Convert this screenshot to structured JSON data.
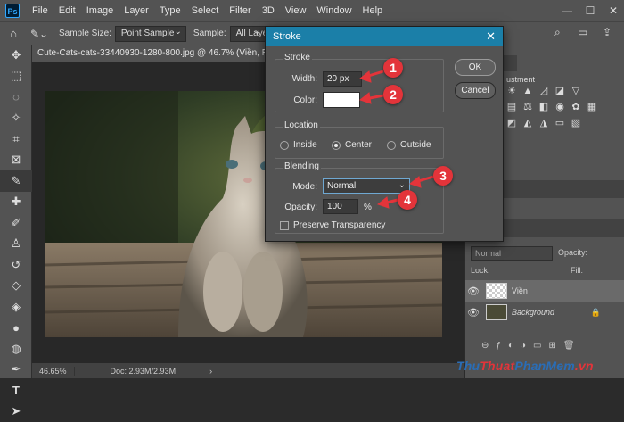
{
  "menubar": {
    "logo": "Ps",
    "items": [
      "File",
      "Edit",
      "Image",
      "Layer",
      "Type",
      "Select",
      "Filter",
      "3D",
      "View",
      "Window",
      "Help"
    ],
    "controls": [
      "—",
      "☐",
      "✕"
    ]
  },
  "options_bar": {
    "sample_size_label": "Sample Size:",
    "sample_size_value": "Point Sample",
    "sample_label": "Sample:",
    "sample_value": "All Layers"
  },
  "document": {
    "tab_title": "Cute-Cats-cats-33440930-1280-800.jpg @ 46.7% (Viền, RGB/8#) *",
    "zoom": "46.65%",
    "doc_size": "Doc: 2.93M/2.93M"
  },
  "stroke_dialog": {
    "title": "Stroke",
    "stroke_group": "Stroke",
    "width_label": "Width:",
    "width_value": "20 px",
    "color_label": "Color:",
    "color_value": "#ffffff",
    "location_group": "Location",
    "location_options": [
      "Inside",
      "Center",
      "Outside"
    ],
    "location_selected": "Center",
    "blending_group": "Blending",
    "mode_label": "Mode:",
    "mode_value": "Normal",
    "opacity_label": "Opacity:",
    "opacity_value": "100",
    "opacity_unit": "%",
    "preserve_label": "Preserve Transparency",
    "ok_label": "OK",
    "cancel_label": "Cancel"
  },
  "callouts": [
    "1",
    "2",
    "3",
    "4"
  ],
  "right_panel": {
    "adjustments_title": "ustment",
    "tab_fragment": "ts",
    "blend_mode": "Normal",
    "opacity_label": "Opacity:",
    "lock_label": "Lock:",
    "fill_label": "Fill:",
    "layers": [
      {
        "name": "Viền",
        "selected": true
      },
      {
        "name": "Background",
        "selected": false
      }
    ]
  },
  "watermark": {
    "part1": "Thu",
    "part2": "Thuat",
    "part3": "PhanMem",
    "part4": ".vn"
  },
  "colors": {
    "accent": "#1b7fa8",
    "callout": "#e3343a"
  }
}
